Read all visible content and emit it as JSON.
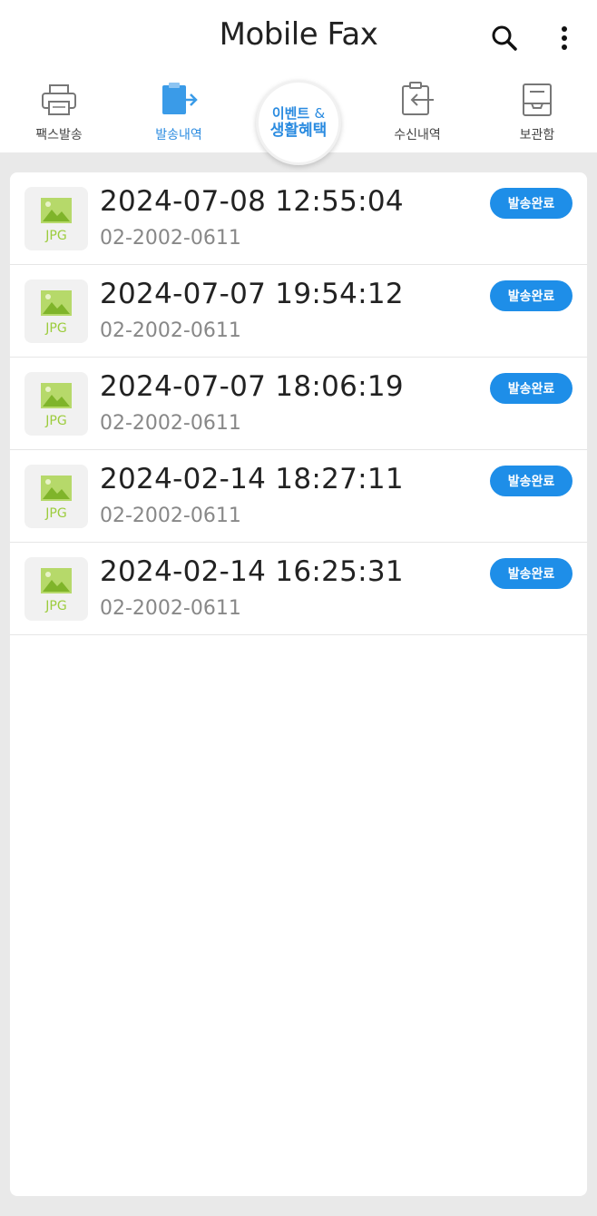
{
  "app": {
    "title": "Mobile Fax"
  },
  "tabs": [
    {
      "label": "팩스발송",
      "icon": "printer-icon",
      "active": false
    },
    {
      "label": "발송내역",
      "icon": "sent-history-icon",
      "active": true
    },
    {
      "label": "수신내역",
      "icon": "received-history-icon",
      "active": false
    },
    {
      "label": "보관함",
      "icon": "archive-box-icon",
      "active": false
    }
  ],
  "event": {
    "line1": "이벤트",
    "amp": "&",
    "line2": "생활혜택"
  },
  "colors": {
    "accent": "#2a8be0",
    "status_bg": "#1e8ee8",
    "jpg_green": "#9ccc3c"
  },
  "history": [
    {
      "file_type": "JPG",
      "datetime": "2024-07-08 12:55:04",
      "number": "02-2002-0611",
      "status": "발송완료"
    },
    {
      "file_type": "JPG",
      "datetime": "2024-07-07 19:54:12",
      "number": "02-2002-0611",
      "status": "발송완료"
    },
    {
      "file_type": "JPG",
      "datetime": "2024-07-07 18:06:19",
      "number": "02-2002-0611",
      "status": "발송완료"
    },
    {
      "file_type": "JPG",
      "datetime": "2024-02-14 18:27:11",
      "number": "02-2002-0611",
      "status": "발송완료"
    },
    {
      "file_type": "JPG",
      "datetime": "2024-02-14 16:25:31",
      "number": "02-2002-0611",
      "status": "발송완료"
    }
  ]
}
